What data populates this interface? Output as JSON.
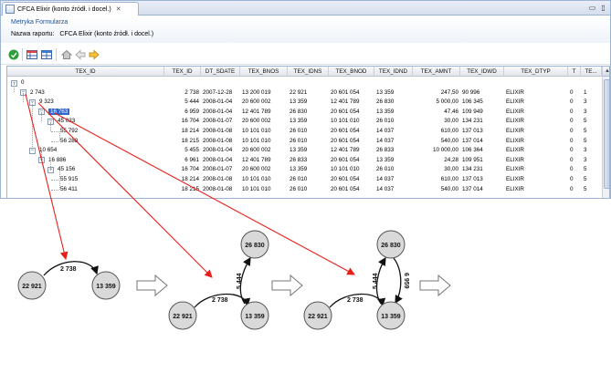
{
  "window": {
    "tab_title": "CFCA Elixir (konto źródł. i docel.)",
    "tab_close": "✕",
    "minimize": "▭",
    "maximize": "▯"
  },
  "editor": {
    "heading": "Metryka Formularza",
    "report_label": "Nazwa raportu:",
    "report_value": "CFCA Elixir (konto źródł. i docel.)"
  },
  "toolbar": {
    "icons": [
      "refresh-icon",
      "table-icon",
      "table-alt-icon",
      "home-icon",
      "back-arrow-icon",
      "forward-arrow-icon"
    ]
  },
  "table": {
    "columns": [
      "TEX_ID",
      "TEX_ID",
      "DT_SDATE",
      "TEX_BNOS",
      "TEX_IDNS",
      "TEX_BNOD",
      "TEX_IDND",
      "TEX_AMNT",
      "TEX_IDWD",
      "TEX_DTYP",
      "T",
      "TE..."
    ],
    "rows": [
      {
        "label": "0",
        "cells": [
          "",
          "",
          "",
          "",
          "",
          "",
          "",
          "",
          "",
          "",
          ""
        ]
      },
      {
        "label": "2 743",
        "cells": [
          "2 738",
          "2007-12-28",
          "13 200 019",
          "22 921",
          "20 601 054",
          "13 359",
          "247,50",
          "90 996",
          "ELIXIR",
          "0",
          "1"
        ]
      },
      {
        "label": "9 323",
        "cells": [
          "5 444",
          "2008-01-04",
          "20 600 002",
          "13 359",
          "12 401 789",
          "26 830",
          "5 000,00",
          "106 345",
          "ELIXIR",
          "0",
          "3"
        ]
      },
      {
        "label": "16 763",
        "cells": [
          "6 959",
          "2008-01-04",
          "12 401 789",
          "26 830",
          "20 601 054",
          "13 359",
          "47,46",
          "109 949",
          "ELIXIR",
          "0",
          "3"
        ]
      },
      {
        "label": "45 033",
        "cells": [
          "16 704",
          "2008-01-07",
          "20 600 002",
          "13 359",
          "10 101 010",
          "26 010",
          "30,00",
          "134 231",
          "ELIXIR",
          "0",
          "5"
        ]
      },
      {
        "label": "55 792",
        "cells": [
          "18 214",
          "2008-01-08",
          "10 101 010",
          "26 010",
          "20 601 054",
          "14 037",
          "610,00",
          "137 013",
          "ELIXIR",
          "0",
          "5"
        ]
      },
      {
        "label": "56 288",
        "cells": [
          "18 215",
          "2008-01-08",
          "10 101 010",
          "26 010",
          "20 601 054",
          "14 037",
          "540,00",
          "137 014",
          "ELIXIR",
          "0",
          "5"
        ]
      },
      {
        "label": "10 654",
        "cells": [
          "5 455",
          "2008-01-04",
          "20 600 002",
          "13 359",
          "12 401 789",
          "26 833",
          "10 000,00",
          "106 364",
          "ELIXIR",
          "0",
          "3"
        ]
      },
      {
        "label": "16 886",
        "cells": [
          "6 961",
          "2008-01-04",
          "12 401 789",
          "26 833",
          "20 601 054",
          "13 359",
          "24,28",
          "109 951",
          "ELIXIR",
          "0",
          "3"
        ]
      },
      {
        "label": "45 156",
        "cells": [
          "16 704",
          "2008-01-07",
          "20 600 002",
          "13 359",
          "10 101 010",
          "26 010",
          "30,00",
          "134 231",
          "ELIXIR",
          "0",
          "5"
        ]
      },
      {
        "label": "55 915",
        "cells": [
          "18 214",
          "2008-01-08",
          "10 101 010",
          "26 010",
          "20 601 054",
          "14 037",
          "610,00",
          "137 013",
          "ELIXIR",
          "0",
          "5"
        ]
      },
      {
        "label": "56 411",
        "cells": [
          "18 215",
          "2008-01-08",
          "10 101 010",
          "26 010",
          "20 601 054",
          "14 037",
          "540,00",
          "137 014",
          "ELIXIR",
          "0",
          "5"
        ]
      }
    ]
  },
  "diagram": {
    "stage1": {
      "node_a": "22 921",
      "node_b": "13 359",
      "edge_ab": "2 738"
    },
    "stage2": {
      "node_a": "22 921",
      "node_b": "13 359",
      "node_c": "26 830",
      "edge_ab": "2 738",
      "edge_bc": "5 444"
    },
    "stage3": {
      "node_a": "22 921",
      "node_b": "13 359",
      "node_c": "26 830",
      "edge_ab": "2 738",
      "edge_bc": "5 444",
      "edge_cb": "6 959"
    },
    "colors": {
      "arrow": "#e8201c",
      "node_fill": "#d9d9d9",
      "node_stroke": "#555555"
    }
  }
}
